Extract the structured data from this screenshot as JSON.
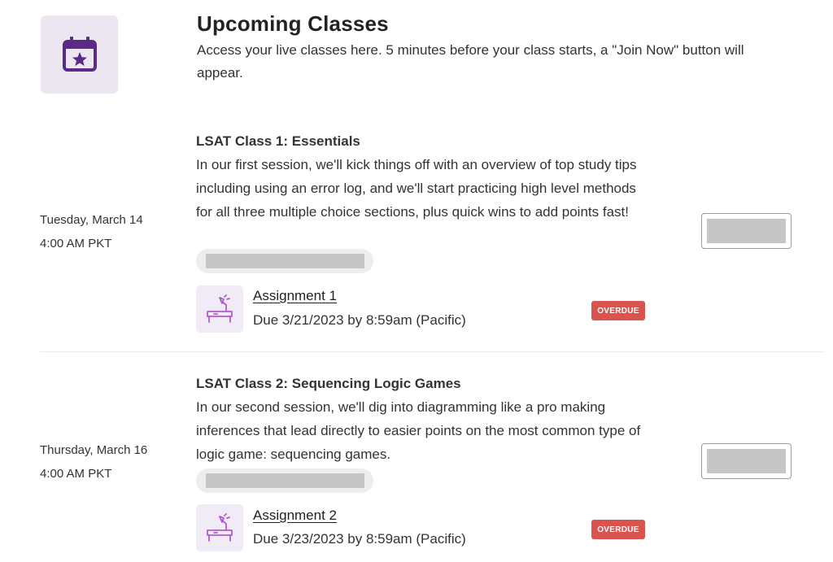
{
  "header": {
    "title": "Upcoming Classes",
    "subtitle": "Access your live classes here. 5 minutes before your class starts, a \"Join Now\" button will appear.",
    "icon": "calendar-star-icon"
  },
  "colors": {
    "brand_purple": "#5b2a86",
    "icon_bg": "#ece6f1",
    "overdue_red": "#d9534f"
  },
  "classes": [
    {
      "date": "Tuesday, March 14",
      "time": "4:00 AM PKT",
      "title": "LSAT Class 1: Essentials",
      "description": "In our first session, we'll kick things off with an overview of top study tips including using an error log, and we'll start practicing high level methods for all three multiple choice sections, plus quick wins to add points fast!",
      "assignment": {
        "label": "Assignment 1",
        "due": "Due 3/21/2023 by 8:59am (Pacific)",
        "status": "OVERDUE",
        "icon": "desk-lamp-icon"
      }
    },
    {
      "date": "Thursday, March 16",
      "time": "4:00 AM PKT",
      "title": "LSAT Class 2: Sequencing Logic Games",
      "description": "In our second session, we'll dig into diagramming like a pro making inferences that lead directly to easier points on the most common type of logic game: sequencing games.",
      "assignment": {
        "label": "Assignment 2",
        "due": "Due 3/23/2023 by 8:59am (Pacific)",
        "status": "OVERDUE",
        "icon": "desk-lamp-icon"
      }
    }
  ]
}
